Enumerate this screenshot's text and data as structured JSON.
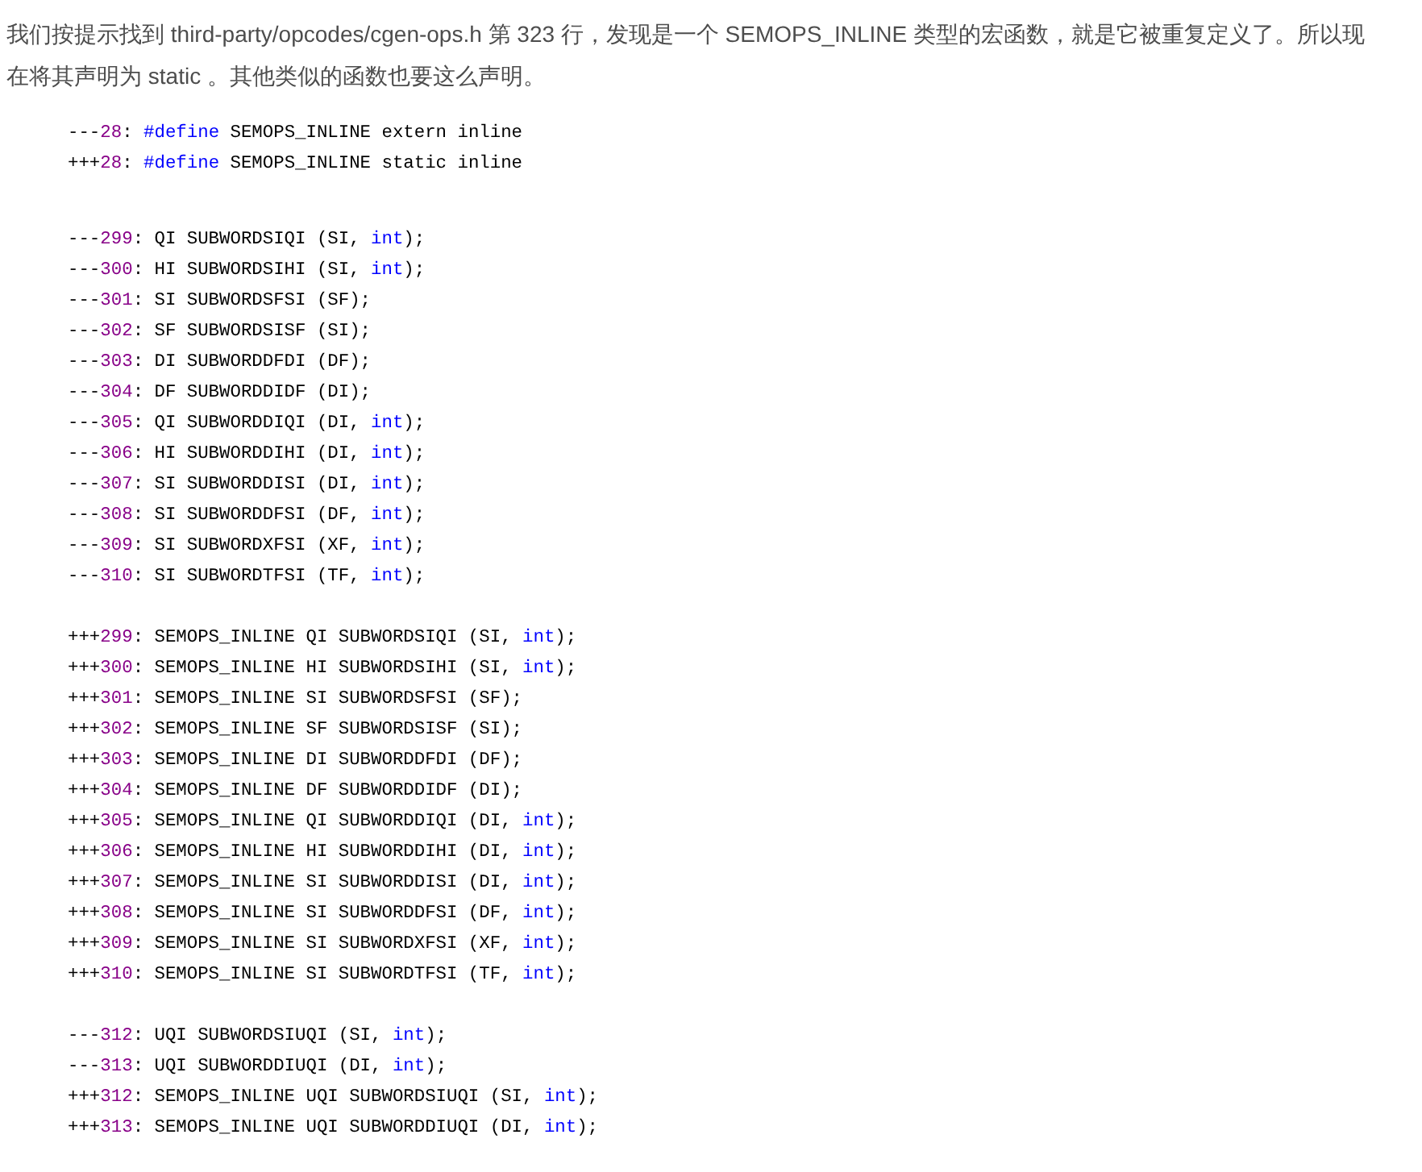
{
  "paragraph": "我们按提示找到 third-party/opcodes/cgen-ops.h 第 323 行，发现是一个 SEMOPS_INLINE 类型的宏函数，就是它被重复定义了。所以现在将其声明为 static 。其他类似的函数也要这么声明。",
  "code_blocks": [
    {
      "lines": [
        {
          "sign": "---",
          "number": "28",
          "code": [
            {
              "kind": "plain",
              "text": ": "
            },
            {
              "kind": "keyword",
              "text": "#define"
            },
            {
              "kind": "plain",
              "text": " SEMOPS_INLINE extern inline"
            }
          ]
        },
        {
          "sign": "+++",
          "number": "28",
          "code": [
            {
              "kind": "plain",
              "text": ": "
            },
            {
              "kind": "keyword",
              "text": "#define"
            },
            {
              "kind": "plain",
              "text": " SEMOPS_INLINE static inline"
            }
          ]
        }
      ]
    },
    {
      "lines": [
        {
          "sign": "---",
          "number": "299",
          "code": [
            {
              "kind": "plain",
              "text": ": QI SUBWORDSIQI (SI, "
            },
            {
              "kind": "keyword",
              "text": "int"
            },
            {
              "kind": "plain",
              "text": ");"
            }
          ]
        },
        {
          "sign": "---",
          "number": "300",
          "code": [
            {
              "kind": "plain",
              "text": ": HI SUBWORDSIHI (SI, "
            },
            {
              "kind": "keyword",
              "text": "int"
            },
            {
              "kind": "plain",
              "text": ");"
            }
          ]
        },
        {
          "sign": "---",
          "number": "301",
          "code": [
            {
              "kind": "plain",
              "text": ": SI SUBWORDSFSI (SF);"
            }
          ]
        },
        {
          "sign": "---",
          "number": "302",
          "code": [
            {
              "kind": "plain",
              "text": ": SF SUBWORDSISF (SI);"
            }
          ]
        },
        {
          "sign": "---",
          "number": "303",
          "code": [
            {
              "kind": "plain",
              "text": ": DI SUBWORDDFDI (DF);"
            }
          ]
        },
        {
          "sign": "---",
          "number": "304",
          "code": [
            {
              "kind": "plain",
              "text": ": DF SUBWORDDIDF (DI);"
            }
          ]
        },
        {
          "sign": "---",
          "number": "305",
          "code": [
            {
              "kind": "plain",
              "text": ": QI SUBWORDDIQI (DI, "
            },
            {
              "kind": "keyword",
              "text": "int"
            },
            {
              "kind": "plain",
              "text": ");"
            }
          ]
        },
        {
          "sign": "---",
          "number": "306",
          "code": [
            {
              "kind": "plain",
              "text": ": HI SUBWORDDIHI (DI, "
            },
            {
              "kind": "keyword",
              "text": "int"
            },
            {
              "kind": "plain",
              "text": ");"
            }
          ]
        },
        {
          "sign": "---",
          "number": "307",
          "code": [
            {
              "kind": "plain",
              "text": ": SI SUBWORDDISI (DI, "
            },
            {
              "kind": "keyword",
              "text": "int"
            },
            {
              "kind": "plain",
              "text": ");"
            }
          ]
        },
        {
          "sign": "---",
          "number": "308",
          "code": [
            {
              "kind": "plain",
              "text": ": SI SUBWORDDFSI (DF, "
            },
            {
              "kind": "keyword",
              "text": "int"
            },
            {
              "kind": "plain",
              "text": ");"
            }
          ]
        },
        {
          "sign": "---",
          "number": "309",
          "code": [
            {
              "kind": "plain",
              "text": ": SI SUBWORDXFSI (XF, "
            },
            {
              "kind": "keyword",
              "text": "int"
            },
            {
              "kind": "plain",
              "text": ");"
            }
          ]
        },
        {
          "sign": "---",
          "number": "310",
          "code": [
            {
              "kind": "plain",
              "text": ": SI SUBWORDTFSI (TF, "
            },
            {
              "kind": "keyword",
              "text": "int"
            },
            {
              "kind": "plain",
              "text": ");"
            }
          ]
        }
      ]
    },
    {
      "lines": [
        {
          "sign": "+++",
          "number": "299",
          "code": [
            {
              "kind": "plain",
              "text": ": SEMOPS_INLINE QI SUBWORDSIQI (SI, "
            },
            {
              "kind": "keyword",
              "text": "int"
            },
            {
              "kind": "plain",
              "text": ");"
            }
          ]
        },
        {
          "sign": "+++",
          "number": "300",
          "code": [
            {
              "kind": "plain",
              "text": ": SEMOPS_INLINE HI SUBWORDSIHI (SI, "
            },
            {
              "kind": "keyword",
              "text": "int"
            },
            {
              "kind": "plain",
              "text": ");"
            }
          ]
        },
        {
          "sign": "+++",
          "number": "301",
          "code": [
            {
              "kind": "plain",
              "text": ": SEMOPS_INLINE SI SUBWORDSFSI (SF);"
            }
          ]
        },
        {
          "sign": "+++",
          "number": "302",
          "code": [
            {
              "kind": "plain",
              "text": ": SEMOPS_INLINE SF SUBWORDSISF (SI);"
            }
          ]
        },
        {
          "sign": "+++",
          "number": "303",
          "code": [
            {
              "kind": "plain",
              "text": ": SEMOPS_INLINE DI SUBWORDDFDI (DF);"
            }
          ]
        },
        {
          "sign": "+++",
          "number": "304",
          "code": [
            {
              "kind": "plain",
              "text": ": SEMOPS_INLINE DF SUBWORDDIDF (DI);"
            }
          ]
        },
        {
          "sign": "+++",
          "number": "305",
          "code": [
            {
              "kind": "plain",
              "text": ": SEMOPS_INLINE QI SUBWORDDIQI (DI, "
            },
            {
              "kind": "keyword",
              "text": "int"
            },
            {
              "kind": "plain",
              "text": ");"
            }
          ]
        },
        {
          "sign": "+++",
          "number": "306",
          "code": [
            {
              "kind": "plain",
              "text": ": SEMOPS_INLINE HI SUBWORDDIHI (DI, "
            },
            {
              "kind": "keyword",
              "text": "int"
            },
            {
              "kind": "plain",
              "text": ");"
            }
          ]
        },
        {
          "sign": "+++",
          "number": "307",
          "code": [
            {
              "kind": "plain",
              "text": ": SEMOPS_INLINE SI SUBWORDDISI (DI, "
            },
            {
              "kind": "keyword",
              "text": "int"
            },
            {
              "kind": "plain",
              "text": ");"
            }
          ]
        },
        {
          "sign": "+++",
          "number": "308",
          "code": [
            {
              "kind": "plain",
              "text": ": SEMOPS_INLINE SI SUBWORDDFSI (DF, "
            },
            {
              "kind": "keyword",
              "text": "int"
            },
            {
              "kind": "plain",
              "text": ");"
            }
          ]
        },
        {
          "sign": "+++",
          "number": "309",
          "code": [
            {
              "kind": "plain",
              "text": ": SEMOPS_INLINE SI SUBWORDXFSI (XF, "
            },
            {
              "kind": "keyword",
              "text": "int"
            },
            {
              "kind": "plain",
              "text": ");"
            }
          ]
        },
        {
          "sign": "+++",
          "number": "310",
          "code": [
            {
              "kind": "plain",
              "text": ": SEMOPS_INLINE SI SUBWORDTFSI (TF, "
            },
            {
              "kind": "keyword",
              "text": "int"
            },
            {
              "kind": "plain",
              "text": ");"
            }
          ]
        }
      ]
    },
    {
      "lines": [
        {
          "sign": "---",
          "number": "312",
          "code": [
            {
              "kind": "plain",
              "text": ": UQI SUBWORDSIUQI (SI, "
            },
            {
              "kind": "keyword",
              "text": "int"
            },
            {
              "kind": "plain",
              "text": ");"
            }
          ]
        },
        {
          "sign": "---",
          "number": "313",
          "code": [
            {
              "kind": "plain",
              "text": ": UQI SUBWORDDIUQI (DI, "
            },
            {
              "kind": "keyword",
              "text": "int"
            },
            {
              "kind": "plain",
              "text": ");"
            }
          ]
        },
        {
          "sign": "+++",
          "number": "312",
          "code": [
            {
              "kind": "plain",
              "text": ": SEMOPS_INLINE UQI SUBWORDSIUQI (SI, "
            },
            {
              "kind": "keyword",
              "text": "int"
            },
            {
              "kind": "plain",
              "text": ");"
            }
          ]
        },
        {
          "sign": "+++",
          "number": "313",
          "code": [
            {
              "kind": "plain",
              "text": ": SEMOPS_INLINE UQI SUBWORDDIUQI (DI, "
            },
            {
              "kind": "keyword",
              "text": "int"
            },
            {
              "kind": "plain",
              "text": ");"
            }
          ]
        }
      ]
    }
  ]
}
